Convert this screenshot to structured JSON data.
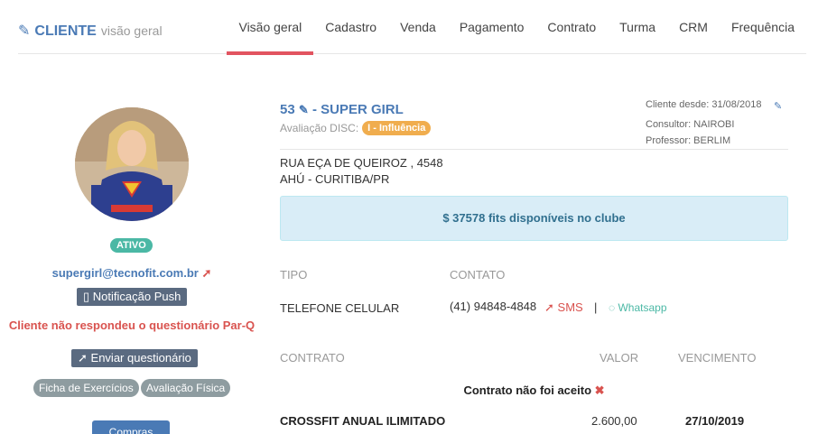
{
  "header": {
    "section_title": "CLIENTE",
    "section_subtitle": "visão geral",
    "tabs": [
      {
        "label": "Visão geral",
        "active": true
      },
      {
        "label": "Cadastro"
      },
      {
        "label": "Venda"
      },
      {
        "label": "Pagamento"
      },
      {
        "label": "Contrato"
      },
      {
        "label": "Turma"
      },
      {
        "label": "CRM"
      },
      {
        "label": "Frequência"
      }
    ]
  },
  "profile": {
    "status": "ATIVO",
    "email": "supergirl@tecnofit.com.br",
    "push_button": "Notificação Push",
    "parq_warning": "Cliente não respondeu o questionário Par-Q",
    "send_questionnaire": "Enviar questionário",
    "workout_sheet": "Ficha de Exercícios",
    "physical_assessment": "Avaliação Física",
    "bottom_button": "Compras"
  },
  "client": {
    "id": "53",
    "name": "- SUPER GIRL",
    "disc_label": "Avaliação DISC:",
    "disc_value": "I - Influência",
    "since": "Cliente desde: 31/08/2018",
    "consultant": "Consultor: NAIROBI",
    "professor": "Professor: BERLIM",
    "address_line1": "RUA EÇA DE QUEIROZ , 4548",
    "address_line2": "AHÚ - CURITIBA/PR",
    "fits": "$ 37578 fits disponíveis no clube"
  },
  "contacts": {
    "headers": {
      "type": "TIPO",
      "contact": "CONTATO"
    },
    "rows": [
      {
        "type": "TELEFONE CELULAR",
        "value": "(41) 94848-4848",
        "sms": "SMS",
        "whatsapp": "Whatsapp"
      }
    ]
  },
  "contracts": {
    "headers": {
      "contract": "CONTRATO",
      "value": "VALOR",
      "due": "VENCIMENTO"
    },
    "not_accepted": "Contrato não foi aceito",
    "rows": [
      {
        "name": "CROSSFIT ANUAL ILIMITADO",
        "value": "2.600,00",
        "due": "27/10/2019"
      }
    ]
  },
  "colors": {
    "brand_blue": "#4a7ab5",
    "active_tab": "#e25460",
    "status_green": "#4bb8a5",
    "danger_red": "#d9534f",
    "disc_orange": "#f0ad4e",
    "fits_bg": "#d9edf7"
  }
}
